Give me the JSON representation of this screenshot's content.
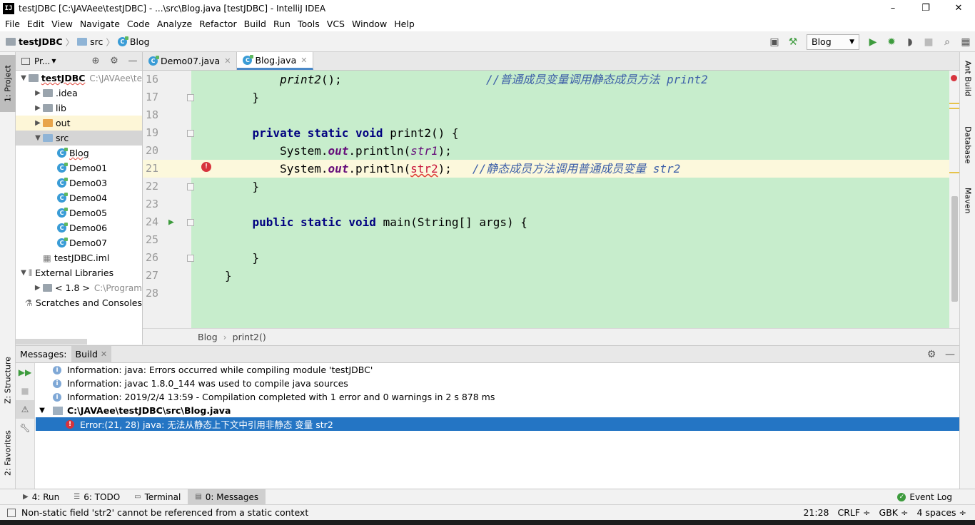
{
  "window": {
    "title": "testJDBC [C:\\JAVAee\\testJDBC] - ...\\src\\Blog.java [testJDBC] - IntelliJ IDEA",
    "icon": "IJ",
    "minimize": "–",
    "maximize": "❐",
    "close": "✕"
  },
  "menu": [
    "File",
    "Edit",
    "View",
    "Navigate",
    "Code",
    "Analyze",
    "Refactor",
    "Build",
    "Run",
    "Tools",
    "VCS",
    "Window",
    "Help"
  ],
  "navbar": {
    "project": "testJDBC",
    "folder": "src",
    "file": "Blog",
    "run_config": "Blog"
  },
  "left_strip": {
    "project": "1: Project",
    "structure": "Z: Structure",
    "favorites": "2: Favorites"
  },
  "right_strip": {
    "ant": "Ant Build",
    "database": "Database",
    "maven": "Maven"
  },
  "project_panel": {
    "title": "Pr...",
    "tree": [
      {
        "label": "testJDBC",
        "muted": "C:\\JAVAee\\te",
        "level": 0,
        "kind": "module",
        "expanded": true
      },
      {
        "label": ".idea",
        "level": 1,
        "kind": "folder",
        "expanded": false
      },
      {
        "label": "lib",
        "level": 1,
        "kind": "folder",
        "expanded": false
      },
      {
        "label": "out",
        "level": 1,
        "kind": "folder-orange",
        "expanded": false
      },
      {
        "label": "src",
        "level": 1,
        "kind": "folder-blue",
        "expanded": true
      },
      {
        "label": "Blog",
        "level": 2,
        "kind": "class"
      },
      {
        "label": "Demo01",
        "level": 2,
        "kind": "class"
      },
      {
        "label": "Demo03",
        "level": 2,
        "kind": "class"
      },
      {
        "label": "Demo04",
        "level": 2,
        "kind": "class"
      },
      {
        "label": "Demo05",
        "level": 2,
        "kind": "class"
      },
      {
        "label": "Demo06",
        "level": 2,
        "kind": "class"
      },
      {
        "label": "Demo07",
        "level": 2,
        "kind": "class"
      },
      {
        "label": "testJDBC.iml",
        "level": 1,
        "kind": "file"
      },
      {
        "label": "External Libraries",
        "level": 0,
        "kind": "libs",
        "expanded": true
      },
      {
        "label": "< 1.8 >",
        "muted": "C:\\Program",
        "level": 1,
        "kind": "sdk",
        "expanded": false
      },
      {
        "label": "Scratches and Consoles",
        "level": 0,
        "kind": "scratch"
      }
    ]
  },
  "editor_tabs": [
    {
      "label": "Demo07.java",
      "active": false
    },
    {
      "label": "Blog.java",
      "active": true
    }
  ],
  "editor": {
    "lines": [
      {
        "n": "16",
        "parts": [
          [
            "",
            "        "
          ],
          [
            "i",
            "print2"
          ],
          [
            "",
            "();                     "
          ],
          [
            "cmt",
            "//普通成员变量调用静态成员方法 print2"
          ]
        ]
      },
      {
        "n": "17",
        "parts": [
          [
            "",
            "    }"
          ]
        ]
      },
      {
        "n": "18",
        "parts": []
      },
      {
        "n": "19",
        "parts": [
          [
            "",
            "    "
          ],
          [
            "kw",
            "private static void "
          ],
          [
            "",
            "print2() {"
          ]
        ]
      },
      {
        "n": "20",
        "parts": [
          [
            "",
            "        System."
          ],
          [
            "fld-b",
            "out"
          ],
          [
            "",
            ".println("
          ],
          [
            "fld",
            "str1"
          ],
          [
            "",
            ");"
          ]
        ]
      },
      {
        "n": "21",
        "parts": [
          [
            "",
            "        System."
          ],
          [
            "fld-b",
            "out"
          ],
          [
            "",
            ".println("
          ],
          [
            "err",
            "str2"
          ],
          [
            "",
            ");   "
          ],
          [
            "cmt",
            "//静态成员方法调用普通成员变量 str2"
          ]
        ]
      },
      {
        "n": "22",
        "parts": [
          [
            "",
            "    }"
          ]
        ]
      },
      {
        "n": "23",
        "parts": []
      },
      {
        "n": "24",
        "parts": [
          [
            "",
            "    "
          ],
          [
            "kw",
            "public static void "
          ],
          [
            "",
            "main(String[] args) {"
          ]
        ]
      },
      {
        "n": "25",
        "parts": []
      },
      {
        "n": "26",
        "parts": [
          [
            "",
            "    }"
          ]
        ]
      },
      {
        "n": "27",
        "parts": [
          [
            "",
            "}"
          ]
        ]
      },
      {
        "n": "28",
        "parts": []
      }
    ]
  },
  "code_breadcrumb": {
    "class": "Blog",
    "method": "print2()"
  },
  "messages": {
    "title": "Messages:",
    "tab": "Build",
    "items": [
      {
        "type": "info",
        "text": "Information: java: Errors occurred while compiling module 'testJDBC'"
      },
      {
        "type": "info",
        "text": "Information: javac 1.8.0_144 was used to compile java sources"
      },
      {
        "type": "info",
        "text": "Information: 2019/2/4 13:59 - Compilation completed with 1 error and 0 warnings in 2 s 878 ms"
      },
      {
        "type": "file",
        "text": "C:\\JAVAee\\testJDBC\\src\\Blog.java"
      },
      {
        "type": "error",
        "text": "Error:(21, 28)  java: 无法从静态上下文中引用非静态 变量 str2"
      }
    ]
  },
  "bottom_tabs": [
    {
      "label": "4: Run",
      "icon": "▶",
      "active": false
    },
    {
      "label": "6: TODO",
      "icon": "☰",
      "active": false
    },
    {
      "label": "Terminal",
      "icon": "▭",
      "active": false
    },
    {
      "label": "0: Messages",
      "icon": "▤",
      "active": true
    }
  ],
  "event_log": "Event Log",
  "status": {
    "message": "Non-static field 'str2' cannot be referenced from a static context",
    "position": "21:28",
    "line_sep": "CRLF ÷",
    "encoding": "GBK ÷",
    "indent": "4 spaces ÷"
  }
}
